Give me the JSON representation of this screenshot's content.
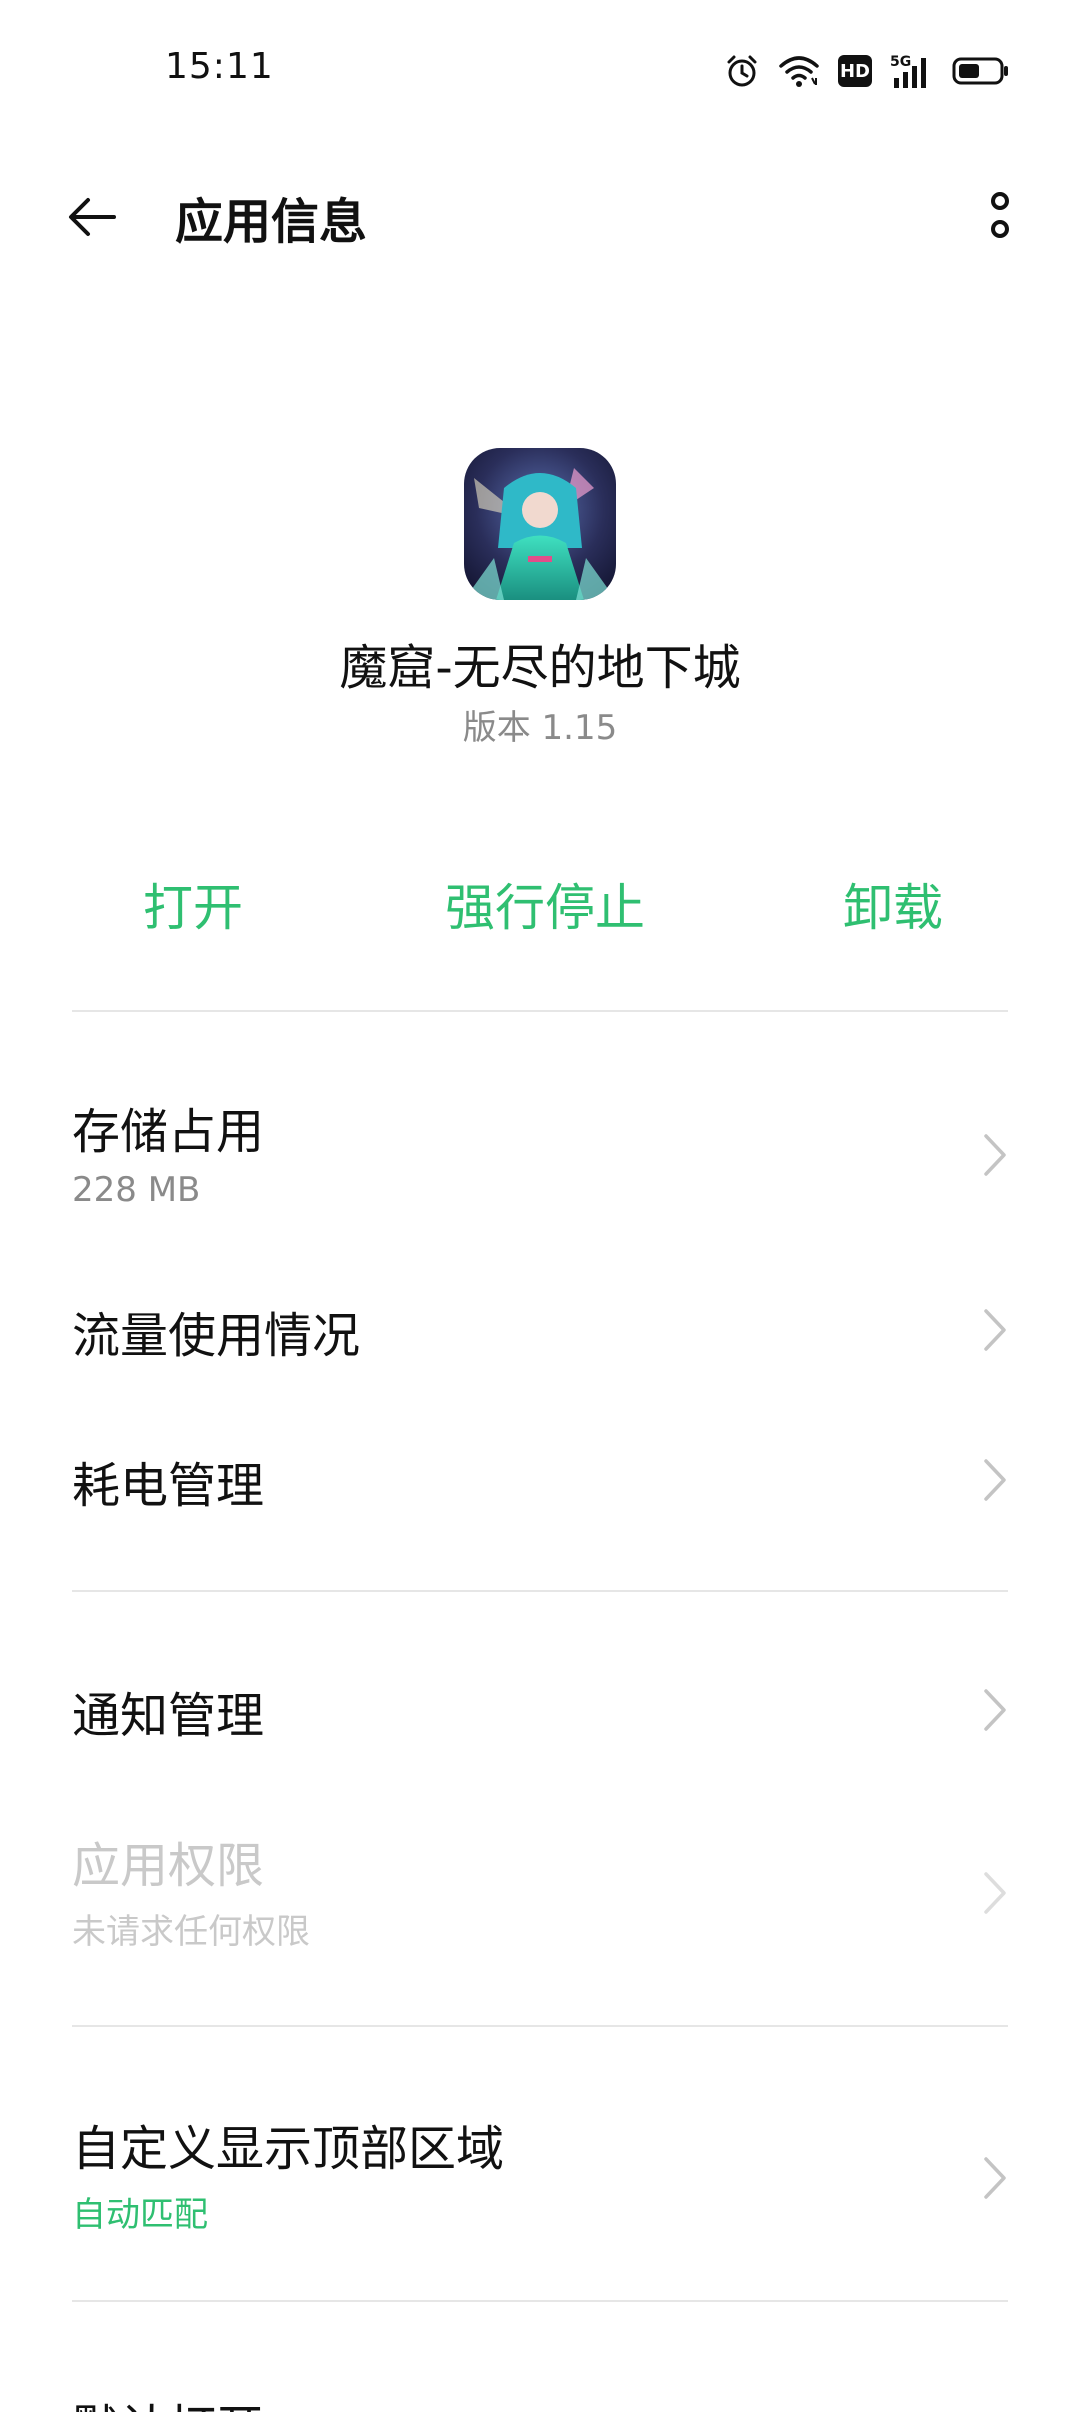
{
  "status_bar": {
    "time": "15:11",
    "icons": [
      "alarm-icon",
      "wifi-icon",
      "hd-icon",
      "5g-signal-icon",
      "battery-icon"
    ],
    "hd_label": "HD",
    "network_label": "5G"
  },
  "header": {
    "title": "应用信息",
    "back_icon": "arrow-left-icon",
    "more_icon": "more-vertical-icon"
  },
  "app": {
    "name": "魔窟-无尽的地下城",
    "version": "版本 1.15"
  },
  "actions": {
    "open": "打开",
    "force_stop": "强行停止",
    "uninstall": "卸载"
  },
  "items": {
    "storage": {
      "title": "存储占用",
      "sub": "228 MB"
    },
    "data_usage": {
      "title": "流量使用情况"
    },
    "battery": {
      "title": "耗电管理"
    },
    "notifications": {
      "title": "通知管理"
    },
    "permissions": {
      "title": "应用权限",
      "sub": "未请求任何权限"
    },
    "display_top": {
      "title": "自定义显示顶部区域",
      "sub": "自动匹配"
    },
    "default_open": {
      "title": "默认打开"
    }
  },
  "colors": {
    "accent": "#2fbf71",
    "secondary_text": "#8a8a8a",
    "disabled_text": "#c9c9c9",
    "divider": "#e6e6e6"
  }
}
